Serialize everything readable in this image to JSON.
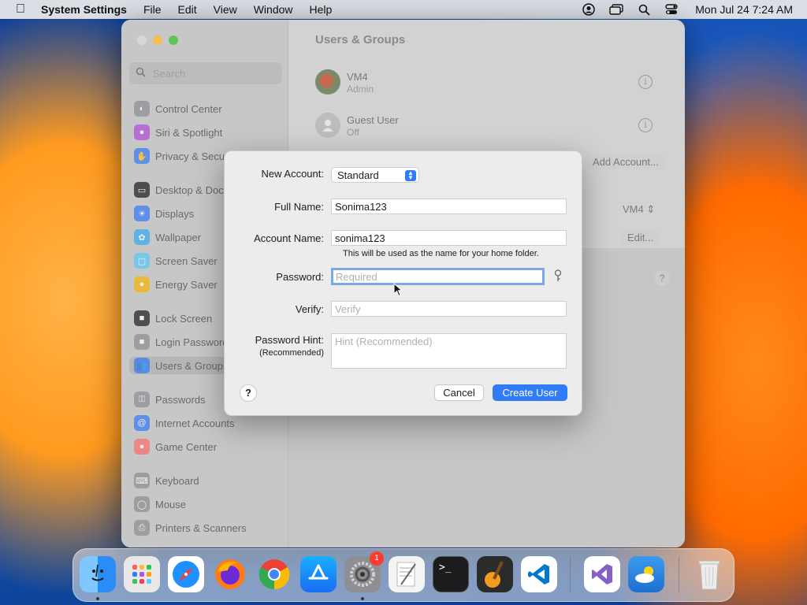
{
  "menubar": {
    "app_name": "System Settings",
    "menus": [
      "File",
      "Edit",
      "View",
      "Window",
      "Help"
    ],
    "clock": "Mon Jul 24  7:24 AM"
  },
  "window": {
    "title": "Users & Groups",
    "search_placeholder": "Search",
    "sidebar": [
      {
        "label": "Control Center",
        "icon": "control-center-icon",
        "color": "#8e8e93"
      },
      {
        "label": "Siri & Spotlight",
        "icon": "siri-icon",
        "color": "#b04ad8"
      },
      {
        "label": "Privacy & Security",
        "icon": "hand-icon",
        "color": "#3478f6"
      },
      {
        "label": "Desktop & Dock",
        "icon": "dock-icon",
        "color": "#1c1c1e"
      },
      {
        "label": "Displays",
        "icon": "sun-icon",
        "color": "#3478f6"
      },
      {
        "label": "Wallpaper",
        "icon": "flower-icon",
        "color": "#35aaf0"
      },
      {
        "label": "Screen Saver",
        "icon": "screen-saver-icon",
        "color": "#5ac8fa"
      },
      {
        "label": "Energy Saver",
        "icon": "bulb-icon",
        "color": "#f7b500"
      },
      {
        "label": "Lock Screen",
        "icon": "lock-icon",
        "color": "#1c1c1e"
      },
      {
        "label": "Login Password",
        "icon": "lock-icon",
        "color": "#8e8e93"
      },
      {
        "label": "Users & Groups",
        "icon": "users-icon",
        "color": "#3478f6"
      },
      {
        "label": "Passwords",
        "icon": "key-icon",
        "color": "#8e8e93"
      },
      {
        "label": "Internet Accounts",
        "icon": "at-icon",
        "color": "#3478f6"
      },
      {
        "label": "Game Center",
        "icon": "game-center-icon",
        "color": "#ff6b6b"
      },
      {
        "label": "Keyboard",
        "icon": "keyboard-icon",
        "color": "#8e8e93"
      },
      {
        "label": "Mouse",
        "icon": "mouse-icon",
        "color": "#8e8e93"
      },
      {
        "label": "Printers & Scanners",
        "icon": "printer-icon",
        "color": "#8e8e93"
      }
    ],
    "users": [
      {
        "name": "VM4",
        "role": "Admin"
      },
      {
        "name": "Guest User",
        "role": "Off"
      }
    ],
    "add_account_label": "Add Account...",
    "auto_login_value": "VM4",
    "edit_label": "Edit...",
    "help_label": "?"
  },
  "dialog": {
    "new_account_label": "New Account:",
    "new_account_value": "Standard",
    "full_name_label": "Full Name:",
    "full_name_value": "Sonima123",
    "account_name_label": "Account Name:",
    "account_name_value": "sonima123",
    "account_name_hint": "This will be used as the name for your home folder.",
    "password_label": "Password:",
    "password_placeholder": "Required",
    "verify_label": "Verify:",
    "verify_placeholder": "Verify",
    "hint_label": "Password Hint:",
    "hint_sublabel": "(Recommended)",
    "hint_placeholder": "Hint (Recommended)",
    "help_label": "?",
    "cancel_label": "Cancel",
    "create_label": "Create User"
  },
  "dock": {
    "settings_badge": "1",
    "apps": [
      {
        "name": "finder-icon",
        "color": "#2a8df5"
      },
      {
        "name": "launchpad-icon",
        "color": "#e8e8e8"
      },
      {
        "name": "safari-icon",
        "color": "#1e90ff"
      },
      {
        "name": "firefox-icon",
        "color": "#ff7a18"
      },
      {
        "name": "chrome-icon",
        "color": "#ffffff"
      },
      {
        "name": "app-store-icon",
        "color": "#1a8cff"
      },
      {
        "name": "system-settings-icon",
        "color": "#8e8e93"
      },
      {
        "name": "textedit-icon",
        "color": "#f4f4f4"
      },
      {
        "name": "terminal-icon",
        "color": "#1c1c1e"
      },
      {
        "name": "garageband-icon",
        "color": "#2b2b2b"
      },
      {
        "name": "vscode-icon",
        "color": "#ffffff"
      },
      {
        "name": "visual-studio-icon",
        "color": "#ffffff"
      },
      {
        "name": "weather-icon",
        "color": "#2f86e0"
      },
      {
        "name": "trash-icon",
        "color": "#dcdcdc"
      }
    ]
  }
}
